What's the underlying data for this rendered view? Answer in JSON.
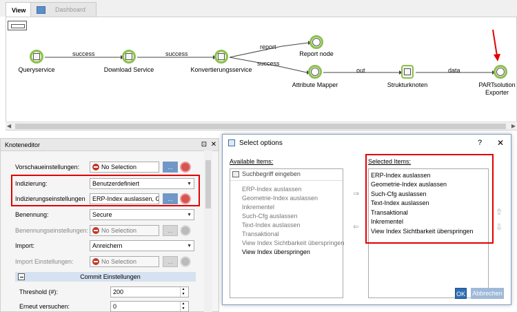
{
  "tabs": [
    {
      "label": "View",
      "active": true
    },
    {
      "label": "Dashboard",
      "active": false
    }
  ],
  "workflow": {
    "nodes": [
      {
        "label": "Queryservice",
        "icon": "service-icon"
      },
      {
        "label": "Download Service",
        "icon": "service-icon"
      },
      {
        "label": "Konvertierungsservice",
        "icon": "service-icon"
      },
      {
        "label": "Report node",
        "icon": "fork-icon"
      },
      {
        "label": "Attribute Mapper",
        "icon": "fork-icon"
      },
      {
        "label": "Strukturknoten",
        "icon": "document-icon"
      },
      {
        "label": "PARTsolution Exporter",
        "icon": "fork-icon"
      }
    ],
    "edges": [
      "success",
      "success",
      "report",
      "success",
      "out",
      "data"
    ]
  },
  "node_editor": {
    "title": "Knoteneditor",
    "rows": [
      {
        "label": "Vorschaueinstellungen:",
        "value": "No Selection",
        "kind": "selection"
      },
      {
        "label": "Indizierung:",
        "value": "Benutzerdefiniert",
        "kind": "dropdown"
      },
      {
        "label": "Indizierungseinstellungen",
        "value": "ERP-Index auslassen, Ged",
        "kind": "selection"
      },
      {
        "label": "Benennung:",
        "value": "Secure",
        "kind": "dropdown"
      },
      {
        "label": "Benennungseinstellungen:",
        "value": "No Selection",
        "kind": "selection-disabled"
      },
      {
        "label": "Import:",
        "value": "Anreichern",
        "kind": "dropdown"
      },
      {
        "label": "Import Einstellungen:",
        "value": "No Selection",
        "kind": "selection-disabled"
      }
    ],
    "section_title": "Commit Einstellungen",
    "numeric_rows": [
      {
        "label": "Threshold (#):",
        "value": "200"
      },
      {
        "label": "Erneut versuchen:",
        "value": "0"
      }
    ],
    "button_dots": "..."
  },
  "dialog": {
    "title": "Select options",
    "help": "?",
    "close": "✕",
    "available_label": "Available Items:",
    "search_placeholder": "Suchbegriff eingeben",
    "available_items": [
      "ERP-Index auslassen",
      "Geometrie-Index auslassen",
      "Inkrementel",
      "Such-Cfg auslassen",
      "Text-Index auslassen",
      "Transaktional",
      "View Index Sichtbarkeit überspringen",
      "View Index überspringen"
    ],
    "selected_label": "Selected Items:",
    "selected_items": [
      "ERP-Index auslassen",
      "Geometrie-Index auslassen",
      "Such-Cfg auslassen",
      "Text-Index auslassen",
      "Transaktional",
      "Inkrementel",
      "View Index Sichtbarkeit überspringen"
    ],
    "ok_label": "OK",
    "cancel_label": "Abbrechen"
  },
  "colors": {
    "node_ring": "#8cc04b",
    "highlight": "#e00000",
    "accent": "#2f6db5"
  }
}
